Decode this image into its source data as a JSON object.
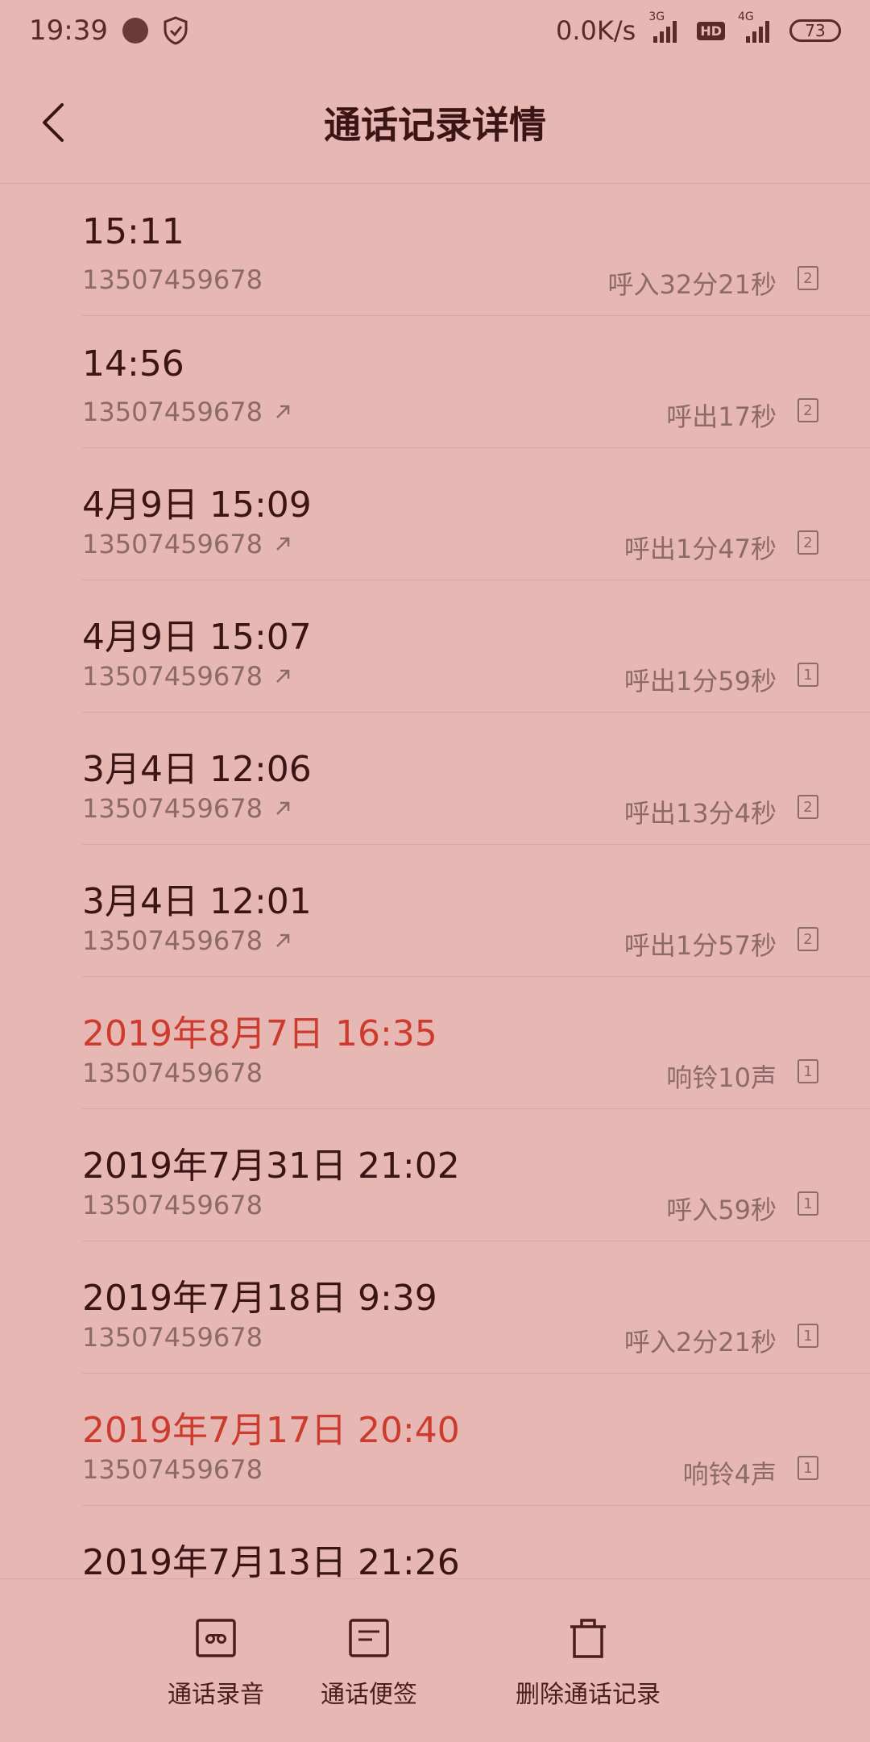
{
  "status_bar": {
    "time": "19:39",
    "speed": "0.0K/s",
    "net1": "3G",
    "hd": "HD",
    "net2": "4G",
    "battery": "73"
  },
  "header": {
    "title": "通话记录详情"
  },
  "calls": [
    {
      "when": "15:11",
      "number": "13507459678",
      "detail": "呼入32分21秒",
      "sim": "2",
      "outgoing": false,
      "missed": false
    },
    {
      "when": "14:56",
      "number": "13507459678",
      "detail": "呼出17秒",
      "sim": "2",
      "outgoing": true,
      "missed": false
    },
    {
      "when": "4月9日 15:09",
      "number": "13507459678",
      "detail": "呼出1分47秒",
      "sim": "2",
      "outgoing": true,
      "missed": false
    },
    {
      "when": "4月9日 15:07",
      "number": "13507459678",
      "detail": "呼出1分59秒",
      "sim": "1",
      "outgoing": true,
      "missed": false
    },
    {
      "when": "3月4日 12:06",
      "number": "13507459678",
      "detail": "呼出13分4秒",
      "sim": "2",
      "outgoing": true,
      "missed": false
    },
    {
      "when": "3月4日 12:01",
      "number": "13507459678",
      "detail": "呼出1分57秒",
      "sim": "2",
      "outgoing": true,
      "missed": false
    },
    {
      "when": "2019年8月7日 16:35",
      "number": "13507459678",
      "detail": "响铃10声",
      "sim": "1",
      "outgoing": false,
      "missed": true
    },
    {
      "when": "2019年7月31日 21:02",
      "number": "13507459678",
      "detail": "呼入59秒",
      "sim": "1",
      "outgoing": false,
      "missed": false
    },
    {
      "when": "2019年7月18日 9:39",
      "number": "13507459678",
      "detail": "呼入2分21秒",
      "sim": "1",
      "outgoing": false,
      "missed": false
    },
    {
      "when": "2019年7月17日 20:40",
      "number": "13507459678",
      "detail": "响铃4声",
      "sim": "1",
      "outgoing": false,
      "missed": true
    },
    {
      "when": "2019年7月13日 21:26",
      "number": "",
      "detail": "",
      "sim": "",
      "outgoing": false,
      "missed": false
    }
  ],
  "actions": [
    {
      "label": "通话录音",
      "icon": "recording-icon"
    },
    {
      "label": "通话便签",
      "icon": "note-icon"
    },
    {
      "label": "删除通话记录",
      "icon": "trash-icon"
    }
  ],
  "colors": {
    "background": "#e6b7b3",
    "missed": "#cc3b2e",
    "primary_text": "#3b1414",
    "secondary_text": "#8b6a68"
  }
}
